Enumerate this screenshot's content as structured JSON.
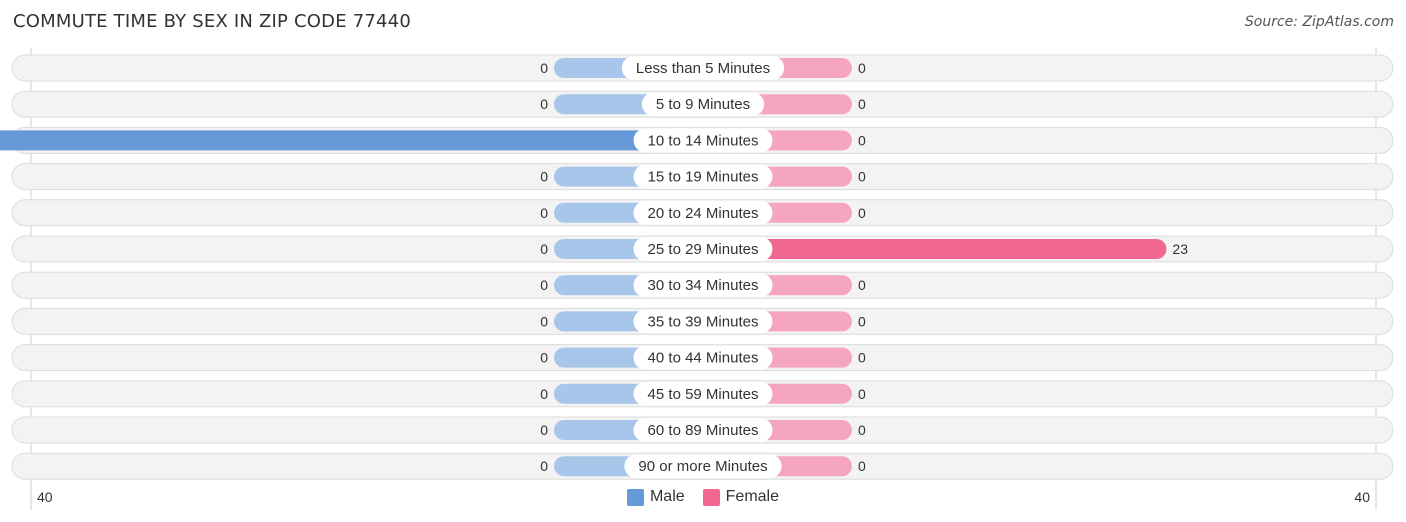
{
  "header": {
    "title": "COMMUTE TIME BY SEX IN ZIP CODE 77440",
    "source": "Source: ZipAtlas.com"
  },
  "colors": {
    "male": "#6699d8",
    "male_light": "#a8c6ea",
    "female": "#f06892",
    "female_light": "#f5a6be",
    "row_bg": "#f3f3f3"
  },
  "chart_data": {
    "type": "bar",
    "orientation": "horizontal-diverging",
    "title": "COMMUTE TIME BY SEX IN ZIP CODE 77440",
    "categories": [
      "Less than 5 Minutes",
      "5 to 9 Minutes",
      "10 to 14 Minutes",
      "15 to 19 Minutes",
      "20 to 24 Minutes",
      "25 to 29 Minutes",
      "30 to 34 Minutes",
      "35 to 39 Minutes",
      "40 to 44 Minutes",
      "45 to 59 Minutes",
      "60 to 89 Minutes",
      "90 or more Minutes"
    ],
    "series": [
      {
        "name": "Male",
        "values": [
          0,
          0,
          40,
          0,
          0,
          0,
          0,
          0,
          0,
          0,
          0,
          0
        ]
      },
      {
        "name": "Female",
        "values": [
          0,
          0,
          0,
          0,
          0,
          23,
          0,
          0,
          0,
          0,
          0,
          0
        ]
      }
    ],
    "xlim": [
      40,
      40
    ],
    "axis_left_label": "40",
    "axis_right_label": "40",
    "legend": [
      "Male",
      "Female"
    ],
    "legend_position": "bottom-center"
  }
}
